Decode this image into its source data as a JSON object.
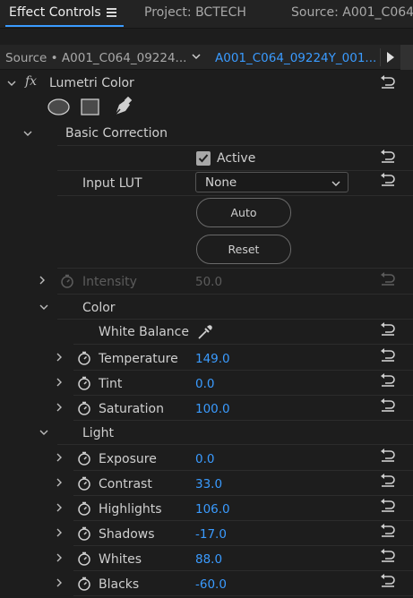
{
  "panel_tabs": [
    {
      "label": "Effect Controls",
      "active": true
    },
    {
      "label": "Project: BCTECH",
      "active": false
    },
    {
      "label": "Source: A001_C064_",
      "active": false
    }
  ],
  "clip_bar": {
    "source_label": "Source • A001_C064_09224...",
    "clip_label": "A001_C064_09224Y_001..."
  },
  "effect": {
    "fx_label": "fx",
    "name": "Lumetri Color",
    "mask_tools": [
      "ellipse-mask-icon",
      "rectangle-mask-icon",
      "pen-mask-icon"
    ]
  },
  "basic_correction": {
    "title": "Basic Correction",
    "active_label": "Active",
    "active_checked": true,
    "input_lut_label": "Input LUT",
    "input_lut_value": "None",
    "auto_label": "Auto",
    "reset_label": "Reset",
    "intensity_label": "Intensity",
    "intensity_value": "50.0"
  },
  "color": {
    "title": "Color",
    "white_balance_label": "White Balance",
    "params": [
      {
        "label": "Temperature",
        "value": "149.0"
      },
      {
        "label": "Tint",
        "value": "0.0"
      },
      {
        "label": "Saturation",
        "value": "100.0"
      }
    ]
  },
  "light": {
    "title": "Light",
    "params": [
      {
        "label": "Exposure",
        "value": "0.0"
      },
      {
        "label": "Contrast",
        "value": "33.0"
      },
      {
        "label": "Highlights",
        "value": "106.0"
      },
      {
        "label": "Shadows",
        "value": "-17.0"
      },
      {
        "label": "Whites",
        "value": "88.0"
      },
      {
        "label": "Blacks",
        "value": "-60.0"
      }
    ]
  },
  "colors": {
    "accent": "#3a9bff",
    "background": "#1d1d1d",
    "text": "#cfcfcf",
    "disabled": "#5c5c5c"
  }
}
